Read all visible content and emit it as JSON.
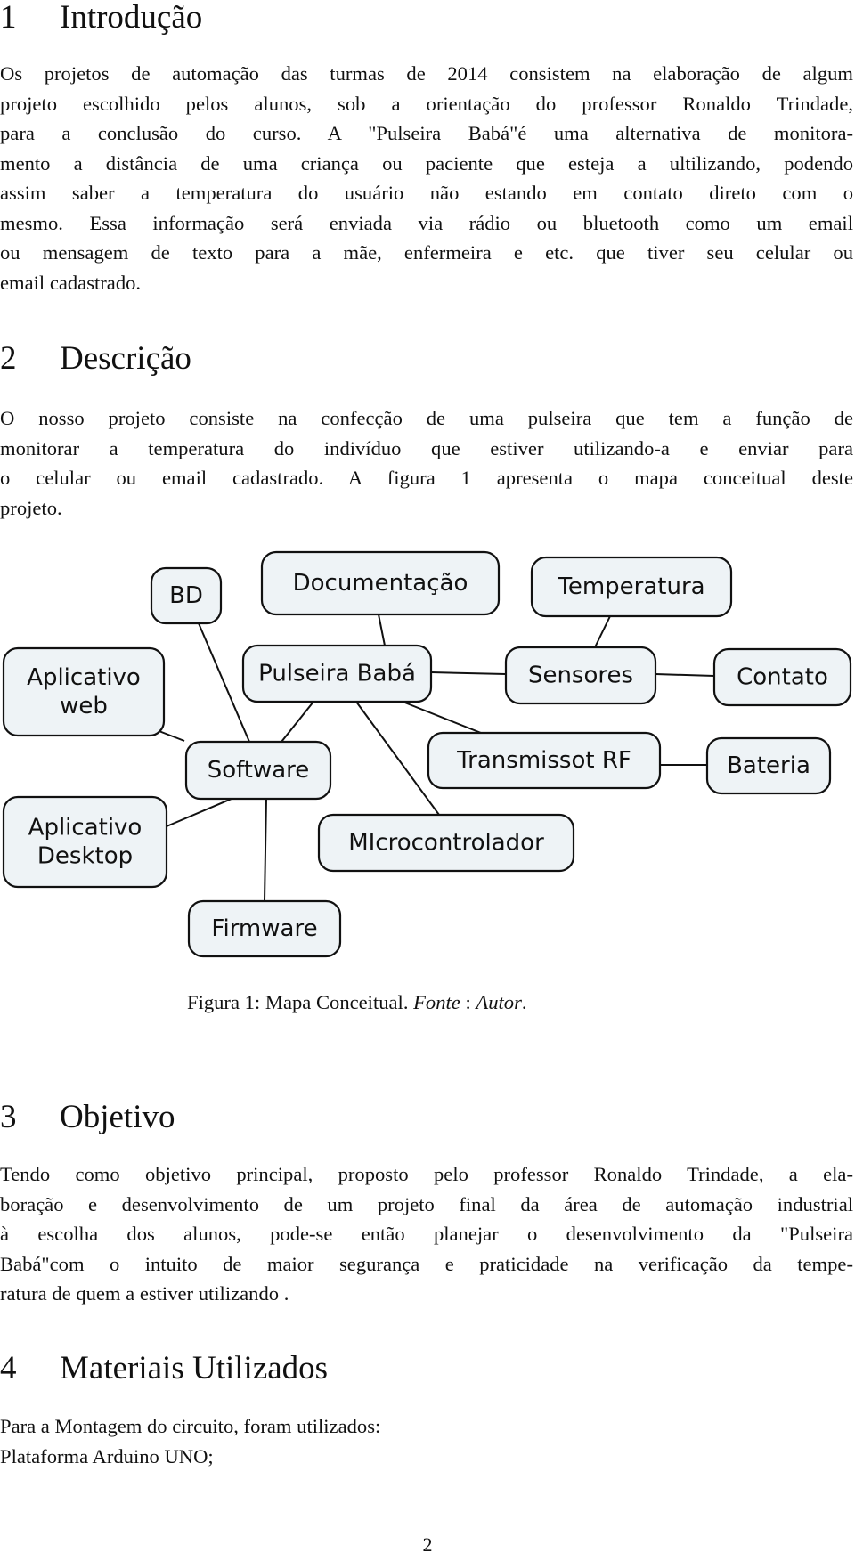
{
  "sections": [
    {
      "number": "1",
      "title": "Introdução",
      "lines": [
        "Os projetos de automação das turmas de 2014 consistem na elaboração de algum",
        "projeto escolhido pelos alunos, sob a orientação do professor Ronaldo Trindade,",
        "para a conclusão do curso.  A \"Pulseira Babá\"é uma alternativa de monitora-",
        "mento a distância de uma criança ou paciente que esteja a ultilizando, podendo",
        "assim saber a temperatura do usuário não estando em contato direto com o",
        "mesmo.  Essa informação será enviada via rádio ou bluetooth como um email",
        "ou mensagem de texto para a mãe, enfermeira e etc.  que tiver seu celular ou",
        "email cadastrado."
      ]
    },
    {
      "number": "2",
      "title": "Descrição",
      "lines": [
        "O nosso projeto consiste na confecção de uma pulseira que tem a função de",
        "monitorar a temperatura do indivíduo que estiver utilizando-a e enviar para",
        "o celular ou email cadastrado.  A figura 1 apresenta o mapa conceitual deste",
        "projeto."
      ]
    },
    {
      "number": "3",
      "title": "Objetivo",
      "lines": [
        "Tendo como objetivo principal, proposto pelo professor Ronaldo Trindade, a ela-",
        "boração e desenvolvimento de um projeto final da área de automação industrial",
        "à escolha dos alunos, pode-se então planejar o desenvolvimento da \"Pulseira",
        "Babá\"com o intuito de maior segurança e praticidade na verificação da tempe-",
        "ratura de quem a estiver utilizando ."
      ]
    },
    {
      "number": "4",
      "title": "Materiais Utilizados",
      "lines": [
        "Para a Montagem do circuito, foram utilizados:",
        "Plataforma Arduino UNO;"
      ]
    }
  ],
  "figure": {
    "caption_prefix": "Figura 1: Mapa Conceitual. ",
    "caption_source_label": "Fonte",
    "caption_separator": " : ",
    "caption_source_value": "Autor",
    "caption_end": ".",
    "nodes": [
      {
        "id": "bd",
        "lines": [
          "BD"
        ]
      },
      {
        "id": "documentacao",
        "lines": [
          "Documentação"
        ]
      },
      {
        "id": "temperatura",
        "lines": [
          "Temperatura"
        ]
      },
      {
        "id": "aplicativo-web",
        "lines": [
          "Aplicativo",
          "web"
        ]
      },
      {
        "id": "pulseira-baba",
        "lines": [
          "Pulseira Babá"
        ]
      },
      {
        "id": "sensores",
        "lines": [
          "Sensores"
        ]
      },
      {
        "id": "contato",
        "lines": [
          "Contato"
        ]
      },
      {
        "id": "software",
        "lines": [
          "Software"
        ]
      },
      {
        "id": "transmissor-rf",
        "lines": [
          "Transmissot RF"
        ]
      },
      {
        "id": "bateria",
        "lines": [
          "Bateria"
        ]
      },
      {
        "id": "aplicativo-desktop",
        "lines": [
          "Aplicativo",
          "Desktop"
        ]
      },
      {
        "id": "microcontrolador",
        "lines": [
          "MIcrocontrolador"
        ]
      },
      {
        "id": "firmware",
        "lines": [
          "Firmware"
        ]
      }
    ],
    "edges": [
      [
        "documentacao",
        "pulseira-baba"
      ],
      [
        "pulseira-baba",
        "sensores"
      ],
      [
        "sensores",
        "temperatura"
      ],
      [
        "sensores",
        "contato"
      ],
      [
        "pulseira-baba",
        "software"
      ],
      [
        "pulseira-baba",
        "microcontrolador"
      ],
      [
        "pulseira-baba",
        "transmissor-rf"
      ],
      [
        "transmissor-rf",
        "bateria"
      ],
      [
        "bd",
        "software"
      ],
      [
        "aplicativo-web",
        "software"
      ],
      [
        "software",
        "aplicativo-desktop"
      ],
      [
        "software",
        "firmware"
      ]
    ]
  },
  "page_number": "2"
}
